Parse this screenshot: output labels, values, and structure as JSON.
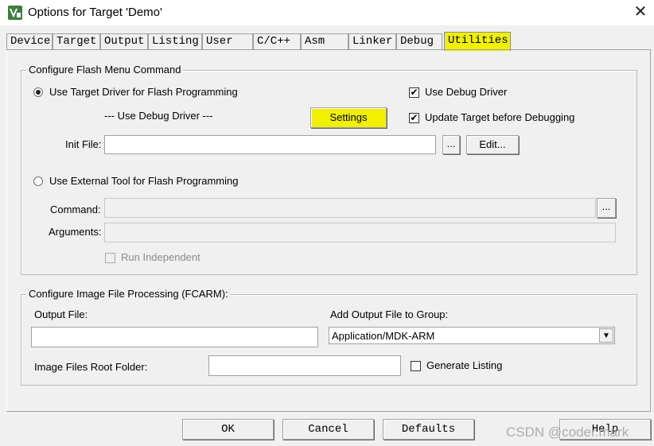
{
  "window": {
    "title": "Options for Target 'Demo'",
    "close_glyph": "✕"
  },
  "tabs": [
    {
      "label": "Device"
    },
    {
      "label": "Target"
    },
    {
      "label": "Output"
    },
    {
      "label": "Listing"
    },
    {
      "label": "User"
    },
    {
      "label": "C/C++"
    },
    {
      "label": "Asm"
    },
    {
      "label": "Linker"
    },
    {
      "label": "Debug"
    },
    {
      "label": "Utilities",
      "active": true
    }
  ],
  "flash_group": {
    "legend": "Configure Flash Menu Command",
    "use_target_driver_label": "Use Target Driver for Flash Programming",
    "use_debug_driver_text": "--- Use Debug Driver ---",
    "settings_button": "Settings",
    "use_debug_driver_check": "Use Debug Driver",
    "update_target_check": "Update Target before Debugging",
    "check_glyph": "✔",
    "init_file_label": "Init File:",
    "init_file_value": "",
    "browse_label": "...",
    "edit_button": "Edit...",
    "use_external_tool_label": "Use External Tool for Flash Programming",
    "command_label": "Command:",
    "command_value": "",
    "arguments_label": "Arguments:",
    "arguments_value": "",
    "run_independent_label": "Run Independent"
  },
  "image_group": {
    "legend": "Configure Image File Processing (FCARM):",
    "output_file_label": "Output File:",
    "output_file_value": "",
    "add_output_label": "Add Output File  to Group:",
    "group_selected": "Application/MDK-ARM",
    "dropdown_glyph": "▼",
    "root_folder_label": "Image Files Root Folder:",
    "root_folder_value": "",
    "generate_listing_label": "Generate Listing"
  },
  "footer": {
    "ok": "OK",
    "cancel": "Cancel",
    "defaults": "Defaults",
    "help": "Help"
  },
  "watermark": "CSDN @coder.mark",
  "colors": {
    "highlight": "#f0f000",
    "app_icon": "#3f7d3f"
  }
}
